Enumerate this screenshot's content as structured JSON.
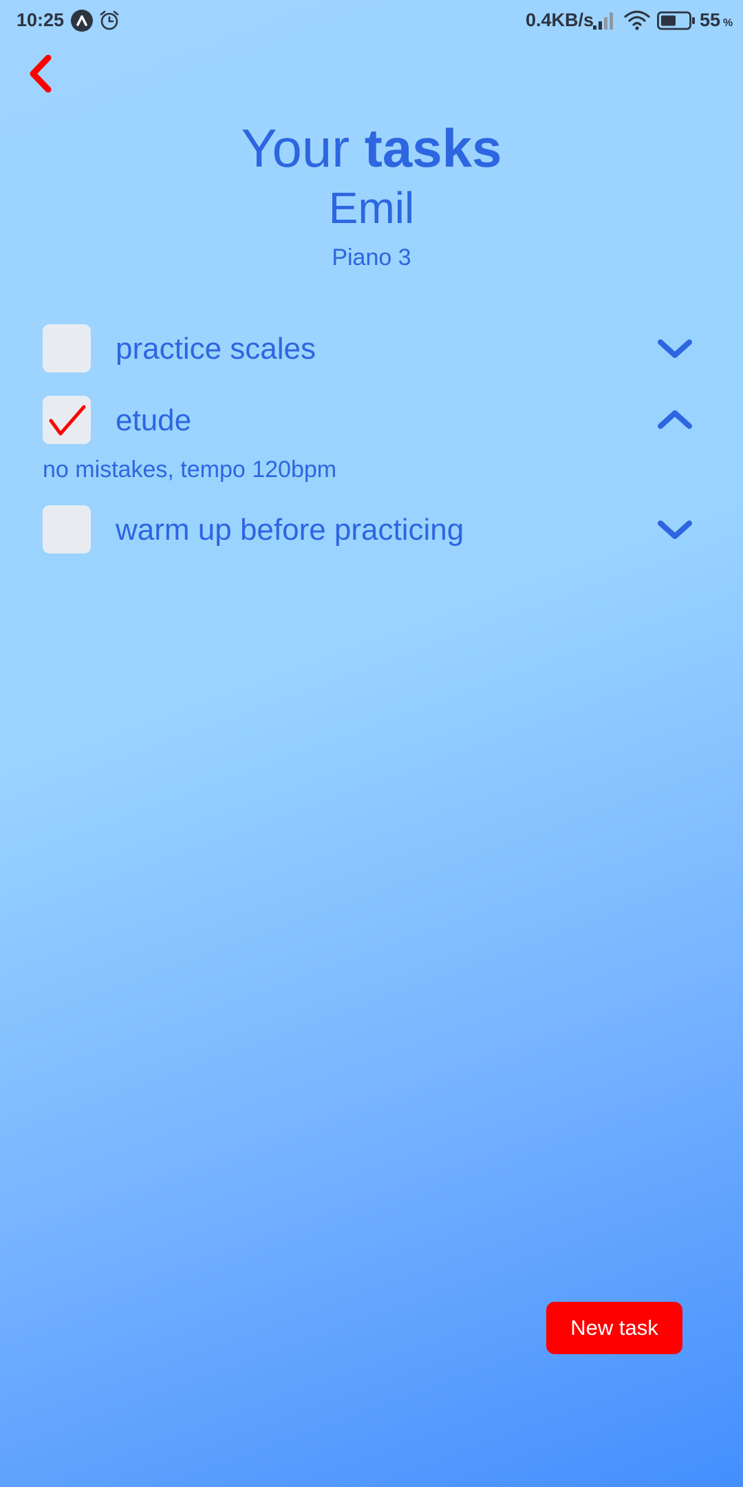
{
  "status_bar": {
    "time": "10:25",
    "network_speed": "0.4KB/s",
    "battery_percent": "55",
    "percent_sign": "%",
    "icons": [
      "app-notification-icon",
      "alarm-icon",
      "signal-icon",
      "wifi-icon",
      "battery-icon"
    ],
    "battery_level": 0.55
  },
  "header": {
    "back_icon": "chevron-left-icon",
    "title_regular": "Your",
    "title_bold": "tasks",
    "student_name": "Emil",
    "course_name": "Piano 3"
  },
  "tasks": [
    {
      "label": "practice scales",
      "checked": false,
      "expanded": false,
      "expand_icon": "chevron-down-icon"
    },
    {
      "label": "etude",
      "checked": true,
      "expanded": true,
      "expand_icon": "chevron-up-icon",
      "note": "no mistakes, tempo 120bpm"
    },
    {
      "label": "warm up before practicing",
      "checked": false,
      "expanded": false,
      "expand_icon": "chevron-down-icon"
    }
  ],
  "actions": {
    "new_task_label": "New task"
  },
  "colors": {
    "accent_text": "#2d66e0",
    "action_red": "#ff0000",
    "checkbox_fill": "#e8ecf1",
    "background_top": "#9ed4ff",
    "background_bottom": "#448ffe"
  }
}
